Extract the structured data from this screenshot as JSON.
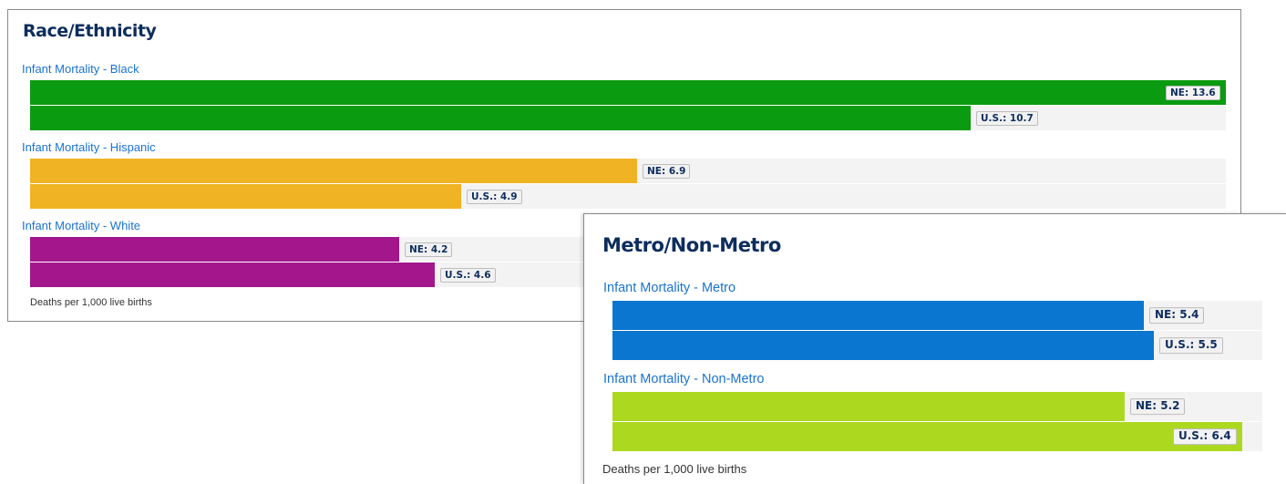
{
  "chart_data": [
    {
      "type": "bar",
      "orientation": "horizontal",
      "title": "Race/Ethnicity",
      "footnote": "Deaths per 1,000 live births",
      "xlim": [
        0,
        13.6
      ],
      "groups": [
        {
          "label": "Infant Mortality - Black",
          "color": "#0a9b10",
          "bars": [
            {
              "name": "NE",
              "value": 13.6,
              "label": "NE: 13.6"
            },
            {
              "name": "U.S.",
              "value": 10.7,
              "label": "U.S.: 10.7"
            }
          ]
        },
        {
          "label": "Infant Mortality - Hispanic",
          "color": "#f0b323",
          "bars": [
            {
              "name": "NE",
              "value": 6.9,
              "label": "NE: 6.9"
            },
            {
              "name": "U.S.",
              "value": 4.9,
              "label": "U.S.: 4.9"
            }
          ]
        },
        {
          "label": "Infant Mortality - White",
          "color": "#a3168c",
          "bars": [
            {
              "name": "NE",
              "value": 4.2,
              "label": "NE: 4.2"
            },
            {
              "name": "U.S.",
              "value": 4.6,
              "label": "U.S.: 4.6"
            }
          ]
        }
      ]
    },
    {
      "type": "bar",
      "orientation": "horizontal",
      "title": "Metro/Non-Metro",
      "footnote": "Deaths per 1,000 live births",
      "xlim": [
        0,
        6.6
      ],
      "groups": [
        {
          "label": "Infant Mortality - Metro",
          "color": "#0a76d0",
          "bars": [
            {
              "name": "NE",
              "value": 5.4,
              "label": "NE: 5.4"
            },
            {
              "name": "U.S.",
              "value": 5.5,
              "label": "U.S.: 5.5"
            }
          ]
        },
        {
          "label": "Infant Mortality - Non-Metro",
          "color": "#acd91f",
          "bars": [
            {
              "name": "NE",
              "value": 5.2,
              "label": "NE: 5.2"
            },
            {
              "name": "U.S.",
              "value": 6.4,
              "label": "U.S.: 6.4"
            }
          ]
        }
      ]
    }
  ]
}
